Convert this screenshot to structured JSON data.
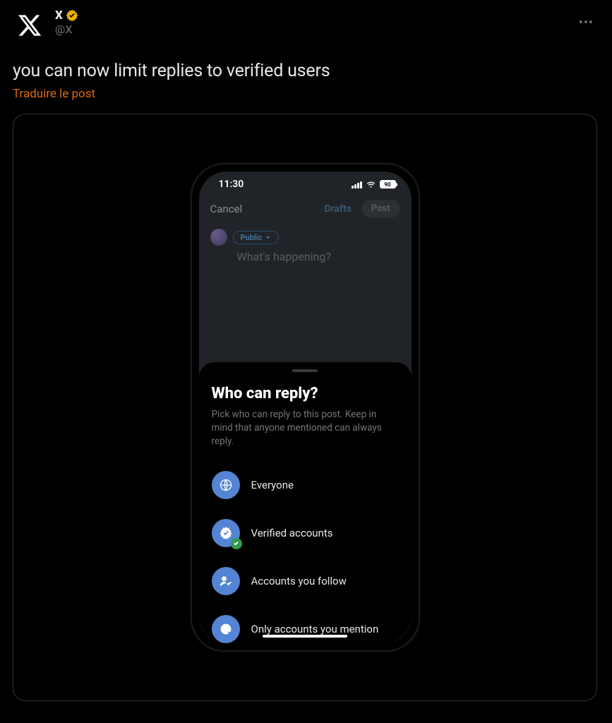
{
  "post": {
    "author_name": "X",
    "author_handle": "@X",
    "text": "you can now limit replies to verified users",
    "translate_label": "Traduire le post"
  },
  "phone": {
    "time": "11:30",
    "battery": "90",
    "cancel": "Cancel",
    "drafts": "Drafts",
    "post_button": "Post",
    "audience_pill": "Public",
    "placeholder": "What's happening?",
    "sheet": {
      "title": "Who can reply?",
      "subtitle": "Pick who can reply to this post. Keep in mind that anyone mentioned can always reply.",
      "options": [
        {
          "label": "Everyone",
          "selected": false
        },
        {
          "label": "Verified accounts",
          "selected": true
        },
        {
          "label": "Accounts you follow",
          "selected": false
        },
        {
          "label": "Only accounts you mention",
          "selected": false
        }
      ]
    }
  }
}
